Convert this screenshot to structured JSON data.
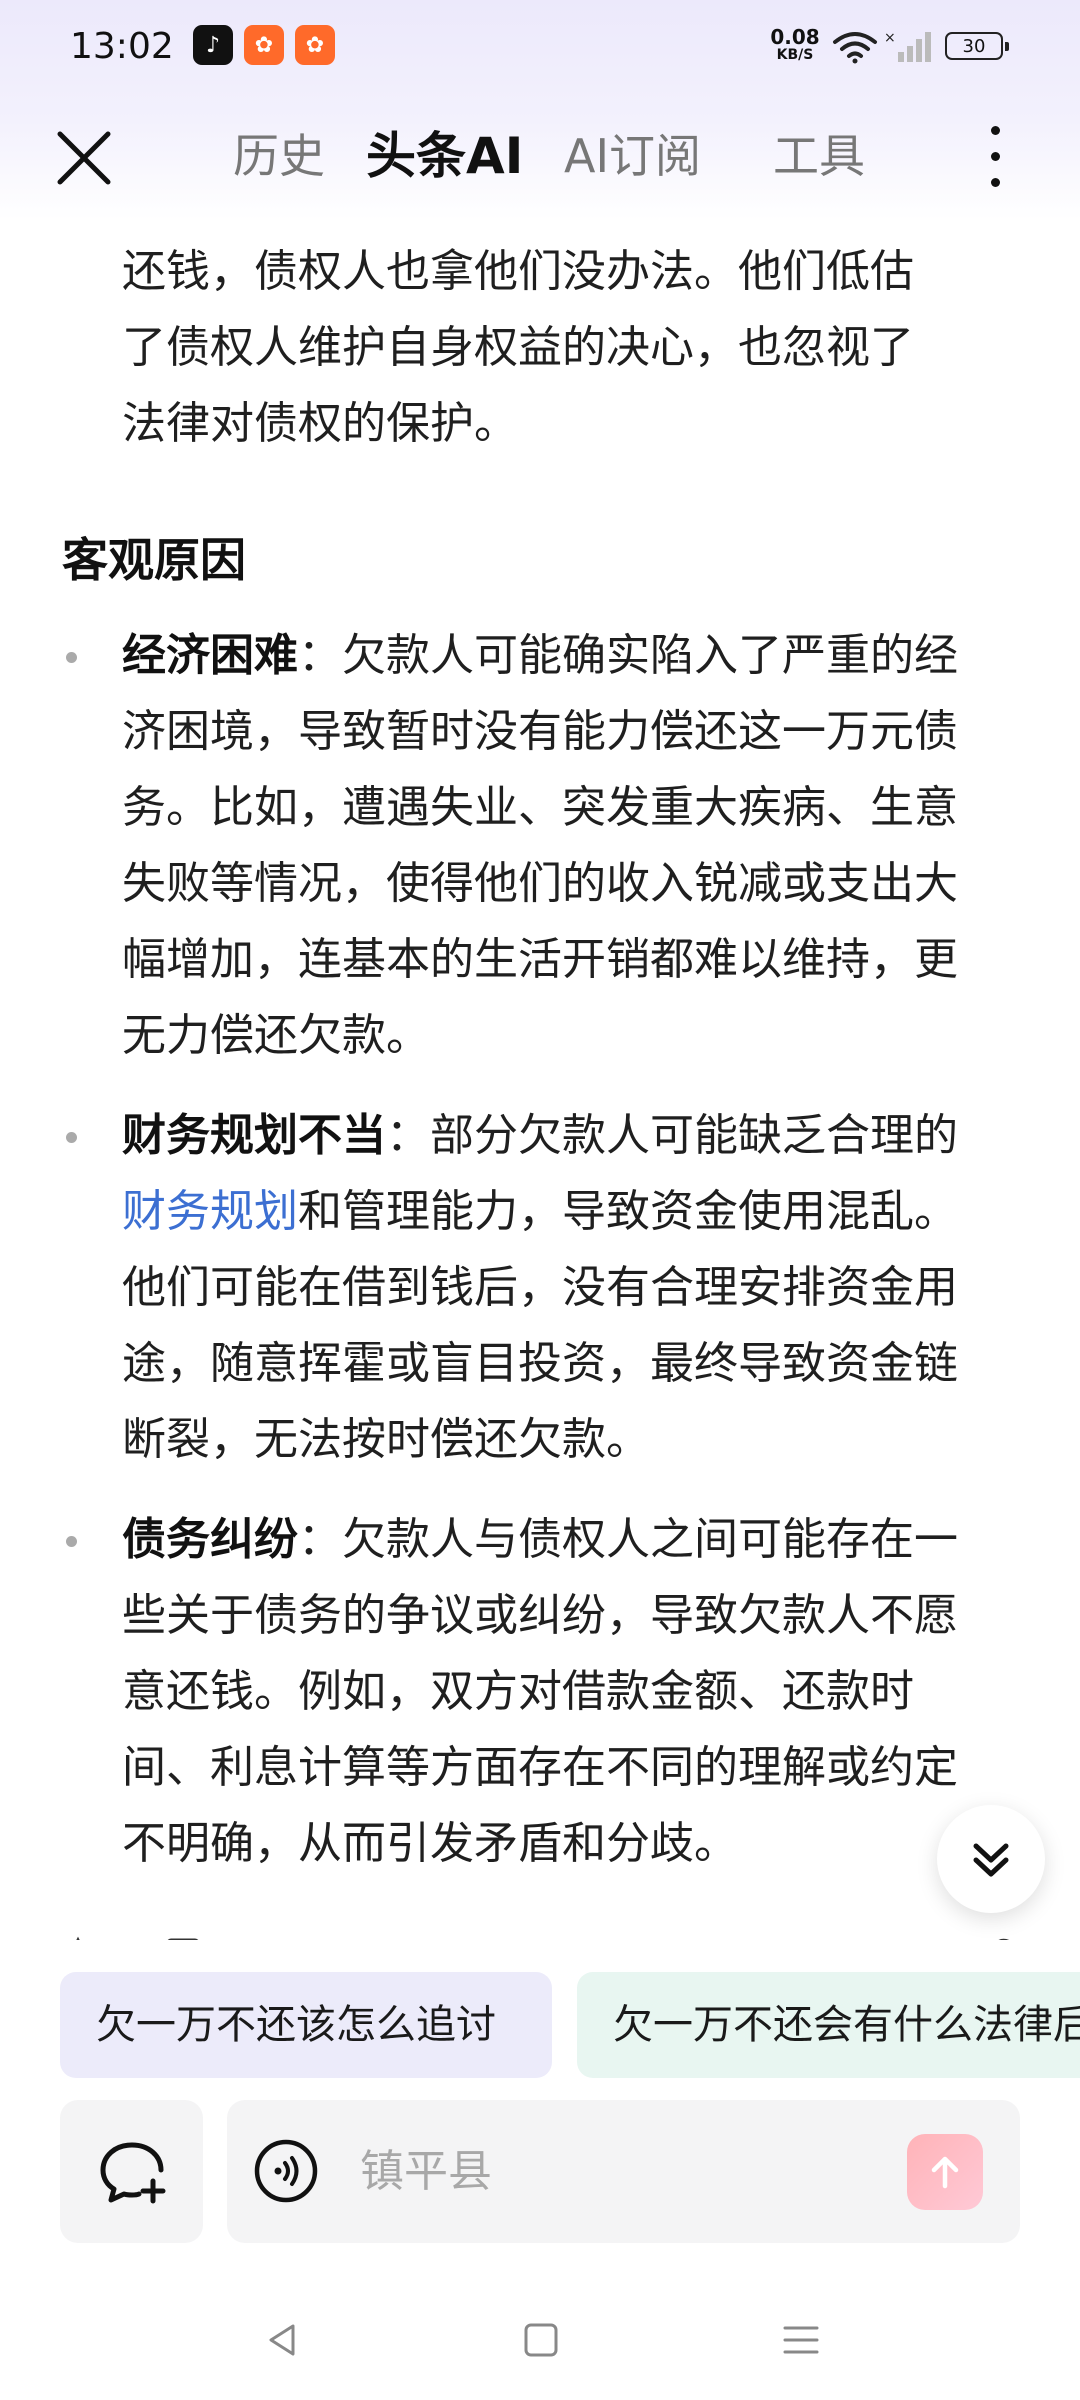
{
  "status_bar": {
    "time": "13:02",
    "net_speed_value": "0.08",
    "net_speed_unit": "KB/S",
    "battery": "30",
    "icons": [
      "tiktok-app-icon",
      "kuaishou-app-icon",
      "kuaishou-lite-app-icon",
      "wifi-icon",
      "signal-icon",
      "battery-icon"
    ]
  },
  "nav": {
    "tabs": [
      {
        "label": "历史",
        "active": false
      },
      {
        "label": "头条AI",
        "active": true
      },
      {
        "label": "AI订阅",
        "active": false
      },
      {
        "label": "工具",
        "active": false
      }
    ]
  },
  "content": {
    "intro_lines": [
      "还钱，债权人也拿他们没办法。他们低估",
      "了债权人维护自身权益的决心，也忽视了",
      "法律对债权的保护。"
    ],
    "section_heading": "客观原因",
    "bullets": [
      {
        "term": "经济困难",
        "sep": "：",
        "text": "欠款人可能确实陷入了严重的经济困境，导致暂时没有能力偿还这一万元债务。比如，遭遇失业、突发重大疾病、生意失败等情况，使得他们的收入锐减或支出大幅增加，连基本的生活开销都难以维持，更无力偿还欠款。"
      },
      {
        "term": "财务规划不当",
        "sep": "：",
        "text_before_link": "部分欠款人可能缺乏合理的",
        "link": "财务规划",
        "text_after_link": "和管理能力，导致资金使用混乱。他们可能在借到钱后，没有合理安排资金用途，随意挥霍或盲目投资，最终导致资金链断裂，无法按时偿还欠款。"
      },
      {
        "term": "债务纠纷",
        "sep": "：",
        "text": "欠款人与债权人之间可能存在一些关于债务的争议或纠纷，导致欠款人不愿意还钱。例如，双方对借款金额、还款时间、利息计算等方面存在不同的理解或约定不明确，从而引发矛盾和分歧。"
      }
    ]
  },
  "suggestions": [
    "欠一万不还该怎么追讨",
    "欠一万不还会有什么法律后果"
  ],
  "input": {
    "placeholder": "镇平县"
  },
  "colors": {
    "link": "#3c6fd2",
    "chip1_bg": "#ecebfa",
    "chip2_bg": "#e8f6f1",
    "send_gradient": "#ffb3b8"
  }
}
